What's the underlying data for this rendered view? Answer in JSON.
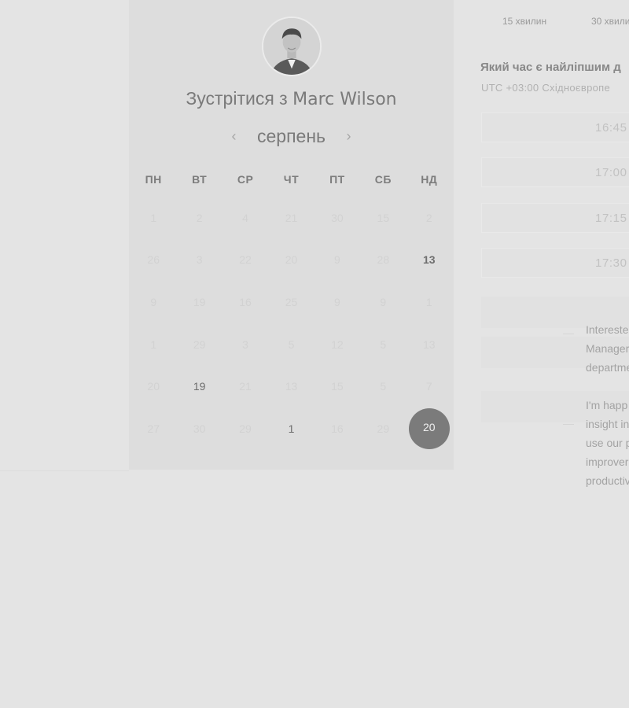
{
  "host": {
    "title_prefix": "Зустрітися з",
    "name": "Marc Wilson"
  },
  "calendar": {
    "month": "серпень",
    "prev_arrow": "‹",
    "next_arrow": "›",
    "weekdays": [
      "ПН",
      "ВТ",
      "СР",
      "ЧТ",
      "ПТ",
      "СБ",
      "НД"
    ],
    "weeks": [
      [
        "1",
        "2",
        "4",
        "21",
        "30",
        "15",
        "2"
      ],
      [
        "26",
        "3",
        "22",
        "20",
        "9",
        "28",
        "13"
      ],
      [
        "9",
        "19",
        "16",
        "25",
        "9",
        "9",
        "1"
      ],
      [
        "1",
        "29",
        "3",
        "5",
        "12",
        "5",
        "13"
      ],
      [
        "20",
        "19",
        "21",
        "13",
        "15",
        "5",
        "7"
      ],
      [
        "27",
        "30",
        "29",
        "1",
        "16",
        "29",
        "20"
      ]
    ]
  },
  "durations": [
    "15 хвилин",
    "30 хвили"
  ],
  "booking": {
    "question": "Який час є найліпшим д",
    "timezone": "UTC +03:00 Східноєвропе",
    "slots": [
      "16:45",
      "17:00",
      "17:15",
      "17:30"
    ]
  },
  "promo": {
    "p1": [
      "Intereste",
      "Manager",
      "departme"
    ],
    "p2": [
      "I'm happ",
      "insight in",
      "use our p",
      "improver",
      "productiv"
    ]
  }
}
